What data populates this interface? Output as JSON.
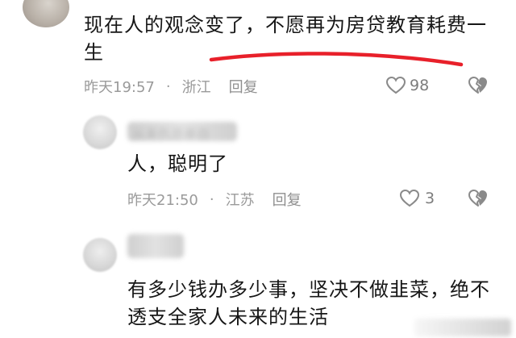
{
  "comments": [
    {
      "text": "现在人的观念变了，不愿再为房贷教育耗费一生",
      "time": "昨天19:57",
      "location": "浙江",
      "reply": "回复",
      "likes": "98"
    },
    {
      "author": "从未仇总亲自",
      "text": "人，聪明了",
      "time": "昨天21:50",
      "location": "江苏",
      "reply": "回复",
      "likes": "3"
    },
    {
      "text": "有多少钱办多少事，坚决不做韭菜，绝不透支全家人未来的生活"
    }
  ],
  "separator": "·",
  "icons": {
    "like": "heart-outline-icon",
    "dislike": "broken-heart-icon"
  },
  "colors": {
    "text": "#161616",
    "meta": "#9a9a9a",
    "annotation": "#e8202a"
  }
}
